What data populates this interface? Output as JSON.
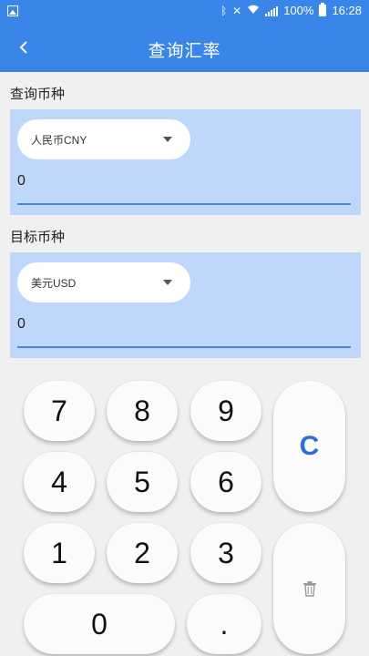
{
  "status_bar": {
    "battery_percent": "100%",
    "time": "16:28",
    "icons": [
      "gallery-icon",
      "bluetooth-icon",
      "mute-icon",
      "wifi-icon",
      "signal-icon",
      "battery-icon"
    ]
  },
  "app_bar": {
    "title": "查询汇率",
    "back_icon": "chevron-left-icon"
  },
  "source": {
    "section_label": "查询币种",
    "selected_currency": "人民币CNY",
    "amount": "0"
  },
  "target": {
    "section_label": "目标币种",
    "selected_currency": "美元USD",
    "amount": "0"
  },
  "keypad": {
    "keys": {
      "k7": "7",
      "k8": "8",
      "k9": "9",
      "k4": "4",
      "k5": "5",
      "k6": "6",
      "k1": "1",
      "k2": "2",
      "k3": "3",
      "k0": "0",
      "kdot": ".",
      "clear": "C"
    },
    "delete_icon": "trash-icon"
  },
  "colors": {
    "primary": "#3a86e8",
    "panel": "#c0d7fc",
    "underline": "#4a86d8",
    "clear_key": "#2a6fd6",
    "background": "#f0f0f0"
  }
}
